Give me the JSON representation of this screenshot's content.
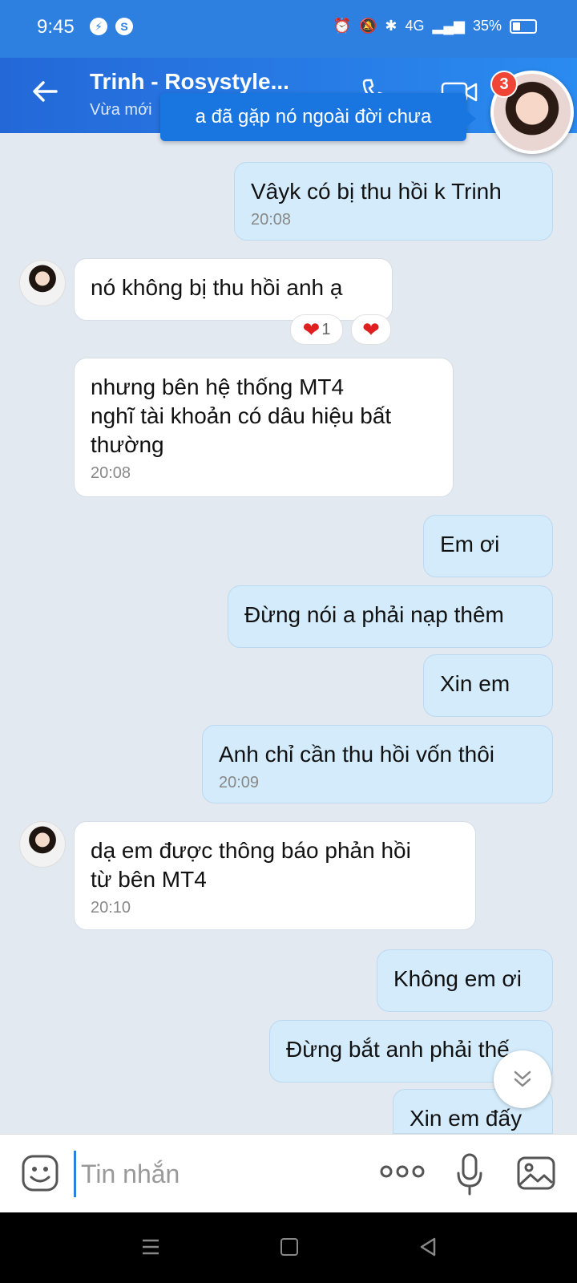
{
  "status_bar": {
    "time": "9:45",
    "network": "4G",
    "battery": "35%",
    "battery_level": 0.35,
    "icons": [
      "messenger-icon",
      "s-app-icon",
      "alarm-icon",
      "mute-icon",
      "bluetooth-icon",
      "signal-icon",
      "battery-icon"
    ]
  },
  "header": {
    "contact_name": "Trinh - Rosystyle...",
    "contact_status": "Vừa mới",
    "icons": [
      "back-arrow-icon",
      "phone-icon",
      "video-call-icon"
    ]
  },
  "tooltip": {
    "text": "a đã gặp nó ngoài đời chưa"
  },
  "chathead": {
    "badge": "3"
  },
  "messages": [
    {
      "side": "out",
      "text": "Vâyk có bị thu hồi k Trinh",
      "time": "20:08"
    },
    {
      "side": "in",
      "text": "nó không bị thu hồi anh ạ",
      "time": ""
    },
    {
      "side": "in",
      "text": "nhưng bên hệ thống  MT4\nnghĩ tài khoản có dâu hiệu bất\nthường",
      "time": "20:08"
    },
    {
      "side": "out",
      "text": "Em ơi",
      "time": ""
    },
    {
      "side": "out",
      "text": "Đừng nói a phải nạp thêm",
      "time": ""
    },
    {
      "side": "out",
      "text": "Xin em",
      "time": ""
    },
    {
      "side": "out",
      "text": "Anh chỉ cần thu hồi vốn thôi",
      "time": "20:09"
    },
    {
      "side": "in",
      "text": "dạ em được thông báo phản hồi\ntừ bên MT4",
      "time": "20:10"
    },
    {
      "side": "out",
      "text": "Không em ơi",
      "time": ""
    },
    {
      "side": "out",
      "text": "Đừng bắt anh phải thế",
      "time": ""
    },
    {
      "side": "out",
      "text": "Xin em đấy",
      "time": ""
    }
  ],
  "reaction": {
    "heart": "❤",
    "count": "1"
  },
  "input_bar": {
    "placeholder": "Tin nhắn",
    "icons": [
      "emoji-icon",
      "more-options-icon",
      "microphone-icon",
      "image-icon"
    ]
  },
  "colors": {
    "header": "#2a7de6",
    "outgoing_bubble": "#d3ebfb",
    "incoming_bubble": "#ffffff",
    "chat_background": "#e2e9f1",
    "badge": "#f04437"
  }
}
